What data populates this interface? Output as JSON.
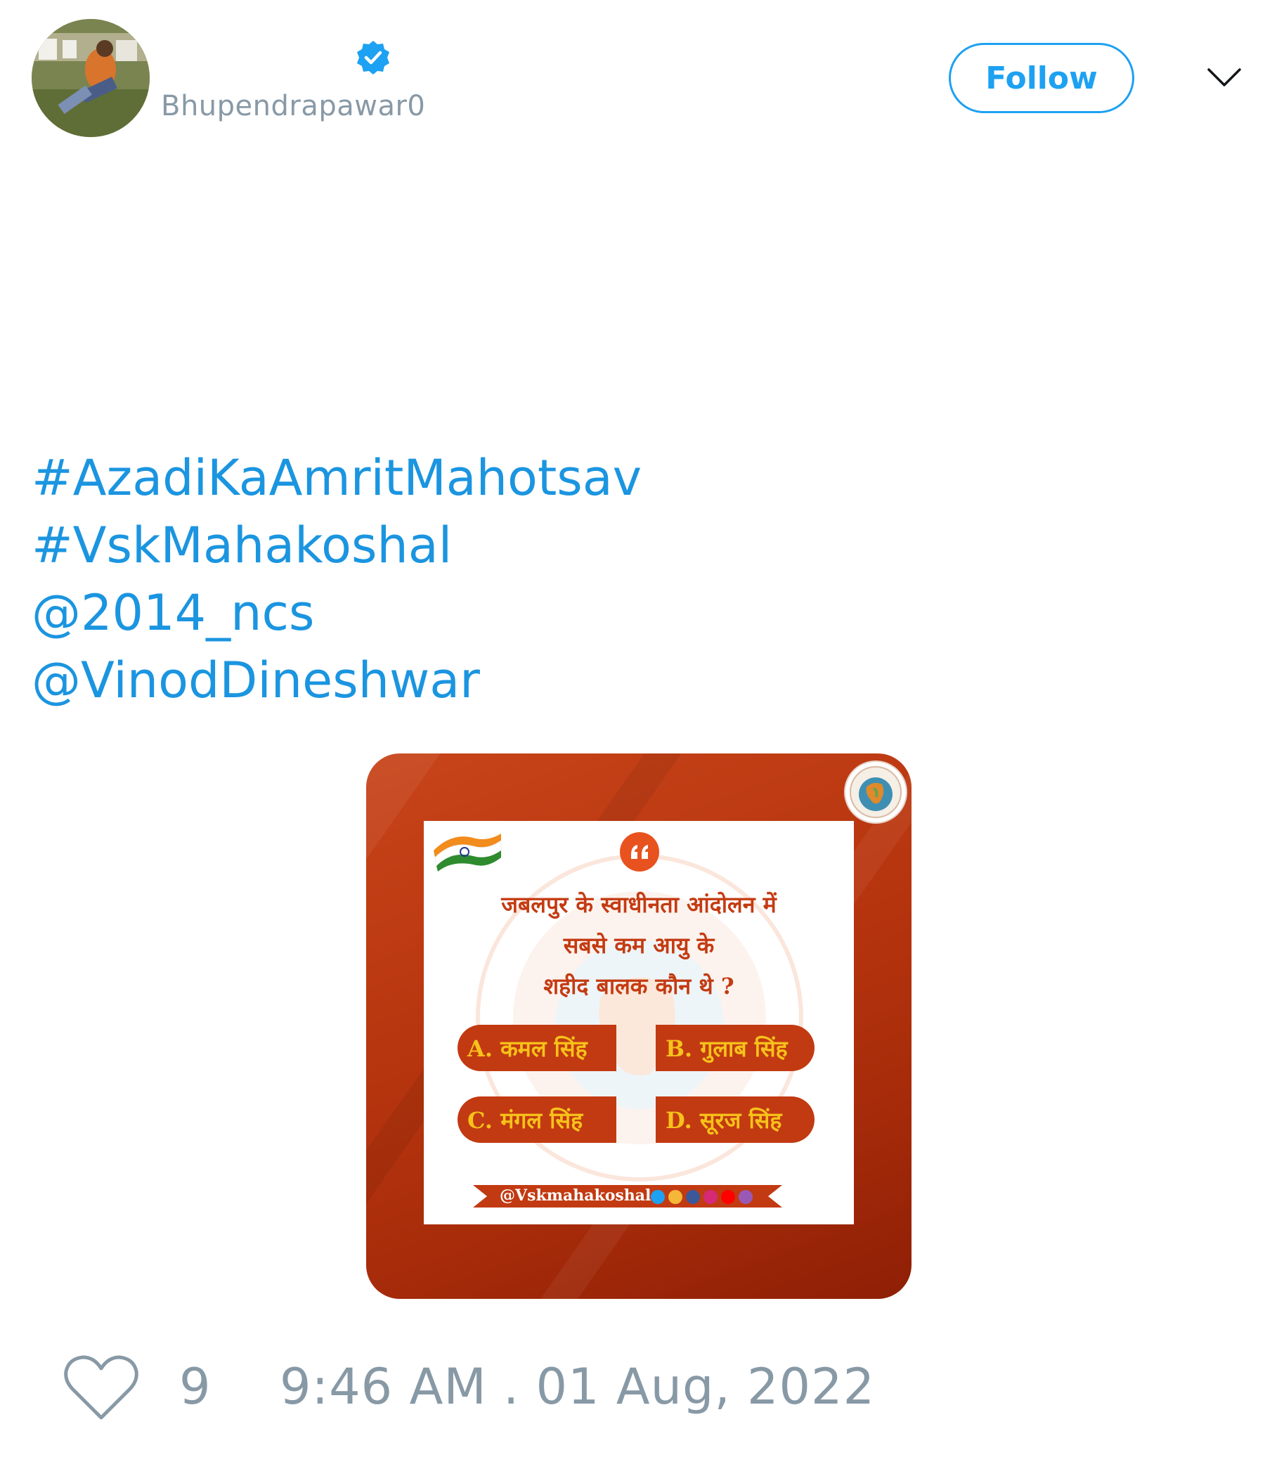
{
  "author": {
    "handle": "Bhupendrapawar0"
  },
  "header": {
    "follow_label": "Follow"
  },
  "tweet": {
    "lines": [
      "#AzadiKaAmritMahotsav",
      "#VskMahakoshal",
      "@2014_ncs",
      "@VinodDineshwar"
    ]
  },
  "media": {
    "question_lines": [
      "जबलपुर के स्वाधीनता आंदोलन में",
      "सबसे कम आयु के",
      "शहीद बालक कौन थे ?"
    ],
    "options": {
      "a": "A. कमल सिंह",
      "b": "B. गुलाब सिंह",
      "c": "C. मंगल सिंह",
      "d": "D. सूरज सिंह"
    },
    "banner_handle": "@Vskmahakoshal"
  },
  "footer": {
    "like_count": "9",
    "timestamp": "9:46 AM . 01 Aug, 2022"
  },
  "colors": {
    "link": "#1b95e0",
    "follow": "#1da1f2",
    "muted": "#8899a6",
    "media_bg": "#b8360f",
    "option_text": "#f7c21a"
  }
}
